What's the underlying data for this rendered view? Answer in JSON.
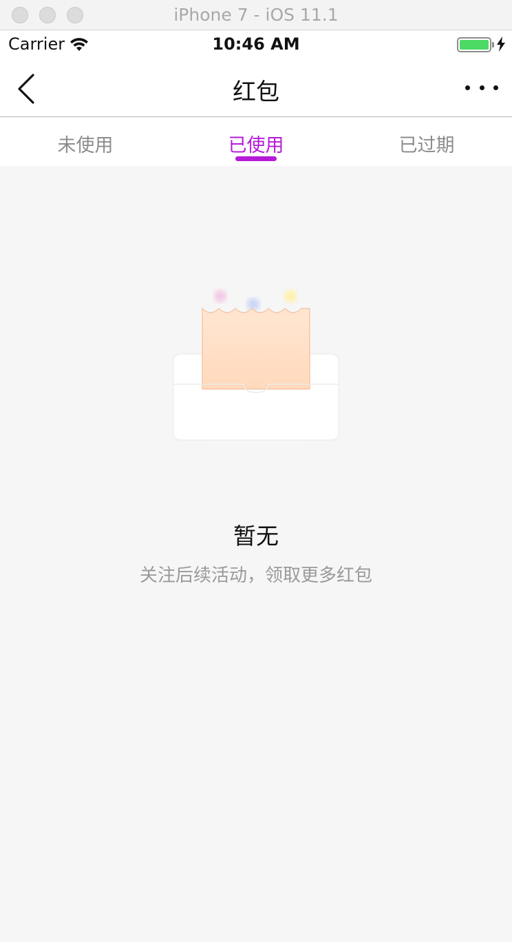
{
  "window": {
    "title": "iPhone 7 - iOS 11.1"
  },
  "status_bar": {
    "carrier": "Carrier",
    "time": "10:46 AM"
  },
  "nav": {
    "title": "红包"
  },
  "tabs": [
    {
      "label": "未使用",
      "active": false
    },
    {
      "label": "已使用",
      "active": true
    },
    {
      "label": "已过期",
      "active": false
    }
  ],
  "empty_state": {
    "title": "暂无",
    "subtitle": "关注后续活动，领取更多红包"
  },
  "colors": {
    "accent": "#b41bd8",
    "background": "#f6f6f6",
    "battery": "#4cd964"
  }
}
